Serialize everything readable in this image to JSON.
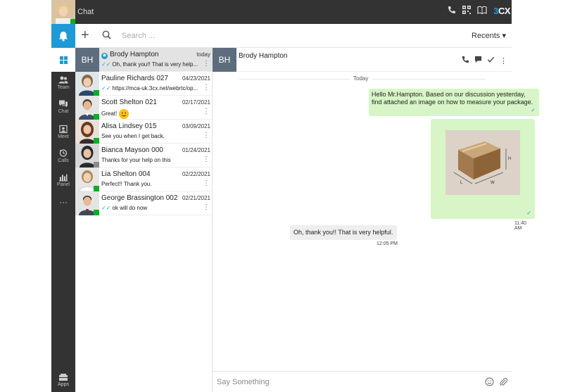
{
  "topbar": {
    "title": "Chat",
    "brand_prefix": "3",
    "brand_suffix": "CX"
  },
  "nav": {
    "items": [
      {
        "label": "Team",
        "icon": "team-icon"
      },
      {
        "label": "Chat",
        "icon": "chat-icon"
      },
      {
        "label": "Meet",
        "icon": "meet-icon"
      },
      {
        "label": "Calls",
        "icon": "calls-icon"
      },
      {
        "label": "Panel",
        "icon": "panel-icon"
      }
    ],
    "more": "···",
    "apps_label": "Apps"
  },
  "list_header": {
    "add": "+",
    "search_placeholder": "Search ...",
    "recents_label": "Recents"
  },
  "conversations": [
    {
      "initials": "BH",
      "name": "Brody Hampton",
      "date": "today",
      "preview": "Oh, thank you!! That is very help..."
    },
    {
      "name": "Pauline Richards 027",
      "date": "04/23/2021",
      "preview": "https://mca-uk.3cx.net/webrtc/op..."
    },
    {
      "name": "Scott Shelton 021",
      "date": "02/17/2021",
      "preview": "Great!"
    },
    {
      "name": "Alisa Lindsey 015",
      "date": "03/09/2021",
      "preview": "See you when I get back."
    },
    {
      "name": "Bianca Mayson 000",
      "date": "01/24/2021",
      "preview": "Thanks for your help on this"
    },
    {
      "name": "Lia Shelton 004",
      "date": "02/22/2021",
      "preview": "Perfect!! Thank you."
    },
    {
      "name": "George Brassington 002",
      "date": "02/21/2021",
      "preview": "ok will do now"
    }
  ],
  "chat": {
    "initials": "BH",
    "name": "Brody Hampton",
    "day_label": "Today",
    "messages": [
      {
        "text": "Hello Mr.Hampton. Based on our discussion yesterday, find attached an image on how to measure your package."
      },
      {
        "image_labels": {
          "h": "H",
          "l": "L",
          "w": "W"
        },
        "time": "11:40 AM"
      },
      {
        "text": "Oh, thank you!! That is very helpful.",
        "time": "12:05 PM"
      }
    ]
  },
  "composer": {
    "placeholder": "Say Something"
  },
  "colors": {
    "accent": "#1e9ad6",
    "dark": "#333333",
    "outgoing": "#d7f5c6",
    "incoming": "#eeeeee",
    "online": "#00b020"
  }
}
